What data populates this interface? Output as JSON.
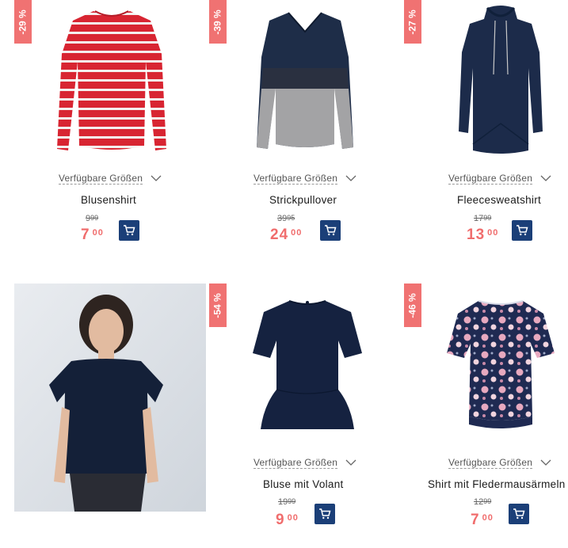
{
  "sizes_label": "Verfügbare Größen",
  "products": [
    {
      "name": "Blusenshirt",
      "discount": "-29 %",
      "old_int": "9",
      "old_dec": "99",
      "new_int": "7",
      "new_dec": "00"
    },
    {
      "name": "Strickpullover",
      "discount": "-39 %",
      "old_int": "39",
      "old_dec": "95",
      "new_int": "24",
      "new_dec": "00"
    },
    {
      "name": "Fleecesweatshirt",
      "discount": "-27 %",
      "old_int": "17",
      "old_dec": "99",
      "new_int": "13",
      "new_dec": "00"
    },
    {
      "name": "",
      "discount": "-54 %"
    },
    {
      "name": "Bluse mit Volant",
      "discount": "",
      "old_int": "19",
      "old_dec": "99",
      "new_int": "9",
      "new_dec": "00"
    },
    {
      "name": "Shirt mit Fledermausärmeln",
      "discount": "-46 %",
      "old_int": "12",
      "old_dec": "99",
      "new_int": "7",
      "new_dec": "00"
    }
  ],
  "colors": {
    "badge": "#f07272",
    "price": "#f06d6d",
    "cart": "#1b3f78"
  },
  "icons": [
    "cart-icon",
    "chevron-down-icon"
  ]
}
